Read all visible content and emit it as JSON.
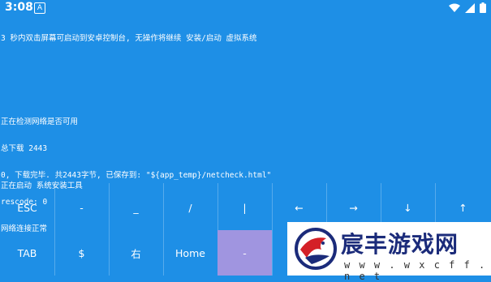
{
  "status_bar": {
    "time": "3:08",
    "notification_letter": "A",
    "icons": [
      "wifi-icon",
      "signal-icon",
      "battery-icon"
    ]
  },
  "terminal": {
    "lines_top": [
      "3 秒内双击屏幕可启动到安卓控制台, 无操作将继续 安装/启动 虚拟系统"
    ],
    "lines_mid": [
      "正在检测网络是否可用",
      "总下载 2443",
      "0, 下载完毕. 共2443字节, 已保存到: \"${app_temp}/netcheck.html\"",
      "rescode: 0",
      "网络连接正常"
    ],
    "lines_bottom": [
      "正在启动 系统安装工具"
    ]
  },
  "extra_keys": {
    "row1": [
      "ESC",
      "-",
      "_",
      "/",
      "|",
      "←",
      "→",
      "↓",
      "↑"
    ],
    "row2": [
      "TAB",
      "$",
      "右",
      "Home",
      "-"
    ],
    "highlight_color": "#a095e0"
  },
  "watermark": {
    "title": "宸丰游戏网",
    "url": "w w w . w x c f f . n e t"
  }
}
